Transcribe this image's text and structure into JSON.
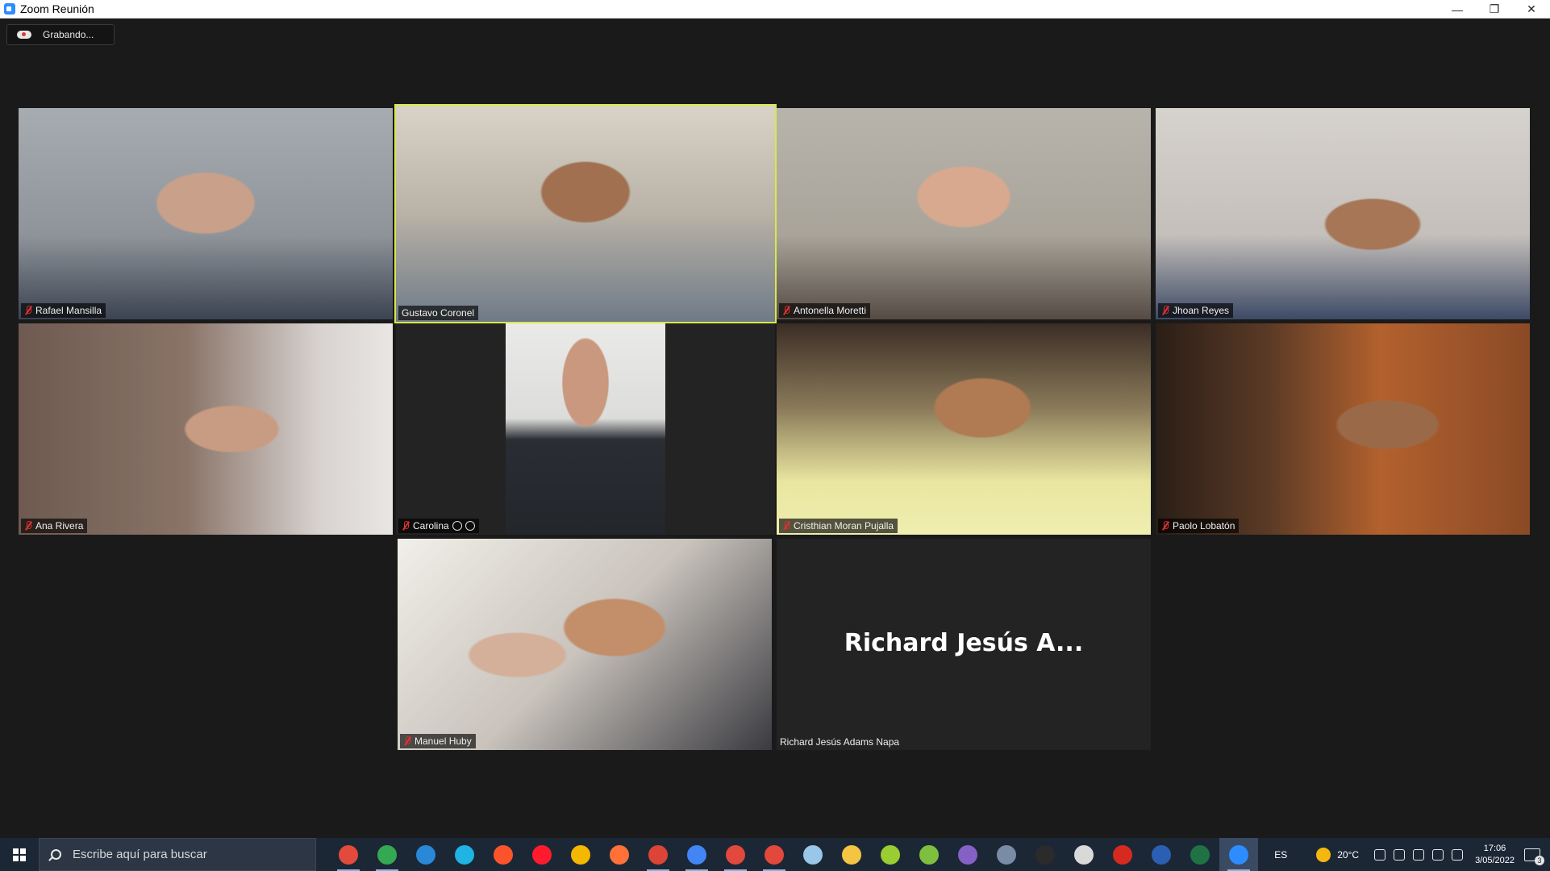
{
  "window": {
    "title": "Zoom Reunión",
    "minimize": "—",
    "restore": "❐",
    "close": "✕"
  },
  "recording": {
    "label": "Grabando..."
  },
  "participants": [
    {
      "name": "Rafael Mansilla",
      "muted": true
    },
    {
      "name": "Gustavo Coronel",
      "muted": false,
      "active_speaker": true
    },
    {
      "name": "Antonella Moretti",
      "muted": true
    },
    {
      "name": "Jhoan Reyes",
      "muted": true
    },
    {
      "name": "Ana Rivera",
      "muted": true
    },
    {
      "name": "Carolina",
      "muted": true
    },
    {
      "name": "Cristhian Moran Pujalla",
      "muted": true
    },
    {
      "name": "Paolo Lobatón",
      "muted": true
    },
    {
      "name": "Manuel Huby",
      "muted": true
    },
    {
      "name": "Richard Jesús Adams Napa",
      "display_name": "Richard Jesús A...",
      "video_off": true
    }
  ],
  "taskbar": {
    "search_placeholder": "Escribe aquí para buscar",
    "pinned_icons": [
      {
        "name": "chrome-icon",
        "color": "#e24a3b",
        "running": true
      },
      {
        "name": "chrome-profile-icon",
        "color": "#34a853",
        "running": true
      },
      {
        "name": "mail-icon",
        "color": "#2a88d8",
        "running": false
      },
      {
        "name": "edge-icon",
        "color": "#1fb4e4",
        "running": false
      },
      {
        "name": "brave-icon",
        "color": "#fb542b",
        "running": false
      },
      {
        "name": "opera-icon",
        "color": "#ff1b2d",
        "running": false
      },
      {
        "name": "chrome-canary-icon",
        "color": "#f5b800",
        "running": false
      },
      {
        "name": "firefox-icon",
        "color": "#ff7139",
        "running": false
      },
      {
        "name": "chrome-alt-icon",
        "color": "#db4437",
        "running": true
      },
      {
        "name": "chrome-profile2-icon",
        "color": "#4285f4",
        "running": true
      },
      {
        "name": "chrome-profile3-icon",
        "color": "#e2483b",
        "running": true
      },
      {
        "name": "chrome-profile4-icon",
        "color": "#e2483b",
        "running": true
      },
      {
        "name": "paint-icon",
        "color": "#9ac6e8",
        "running": false
      },
      {
        "name": "file-explorer-icon",
        "color": "#f4c542",
        "running": false
      },
      {
        "name": "notepad-icon",
        "color": "#9acd32",
        "running": false
      },
      {
        "name": "snipping-tool-icon",
        "color": "#7fbf3f",
        "running": false
      },
      {
        "name": "visual-studio-icon",
        "color": "#8661c5",
        "running": false
      },
      {
        "name": "calculator-icon",
        "color": "#7a8ca5",
        "running": false
      },
      {
        "name": "terminal-icon",
        "color": "#2b2b2b",
        "running": false
      },
      {
        "name": "cloud-app-icon",
        "color": "#d9d9d9",
        "running": false
      },
      {
        "name": "acrobat-icon",
        "color": "#d62a20",
        "running": false
      },
      {
        "name": "word-icon",
        "color": "#2b5fb4",
        "running": false
      },
      {
        "name": "excel-icon",
        "color": "#1f7244",
        "running": false
      },
      {
        "name": "zoom-icon",
        "color": "#2d8cff",
        "running": true,
        "active": true
      }
    ],
    "language": "ES",
    "temperature": "20°C",
    "time": "17:06",
    "date": "3/05/2022",
    "notifications": "3"
  }
}
